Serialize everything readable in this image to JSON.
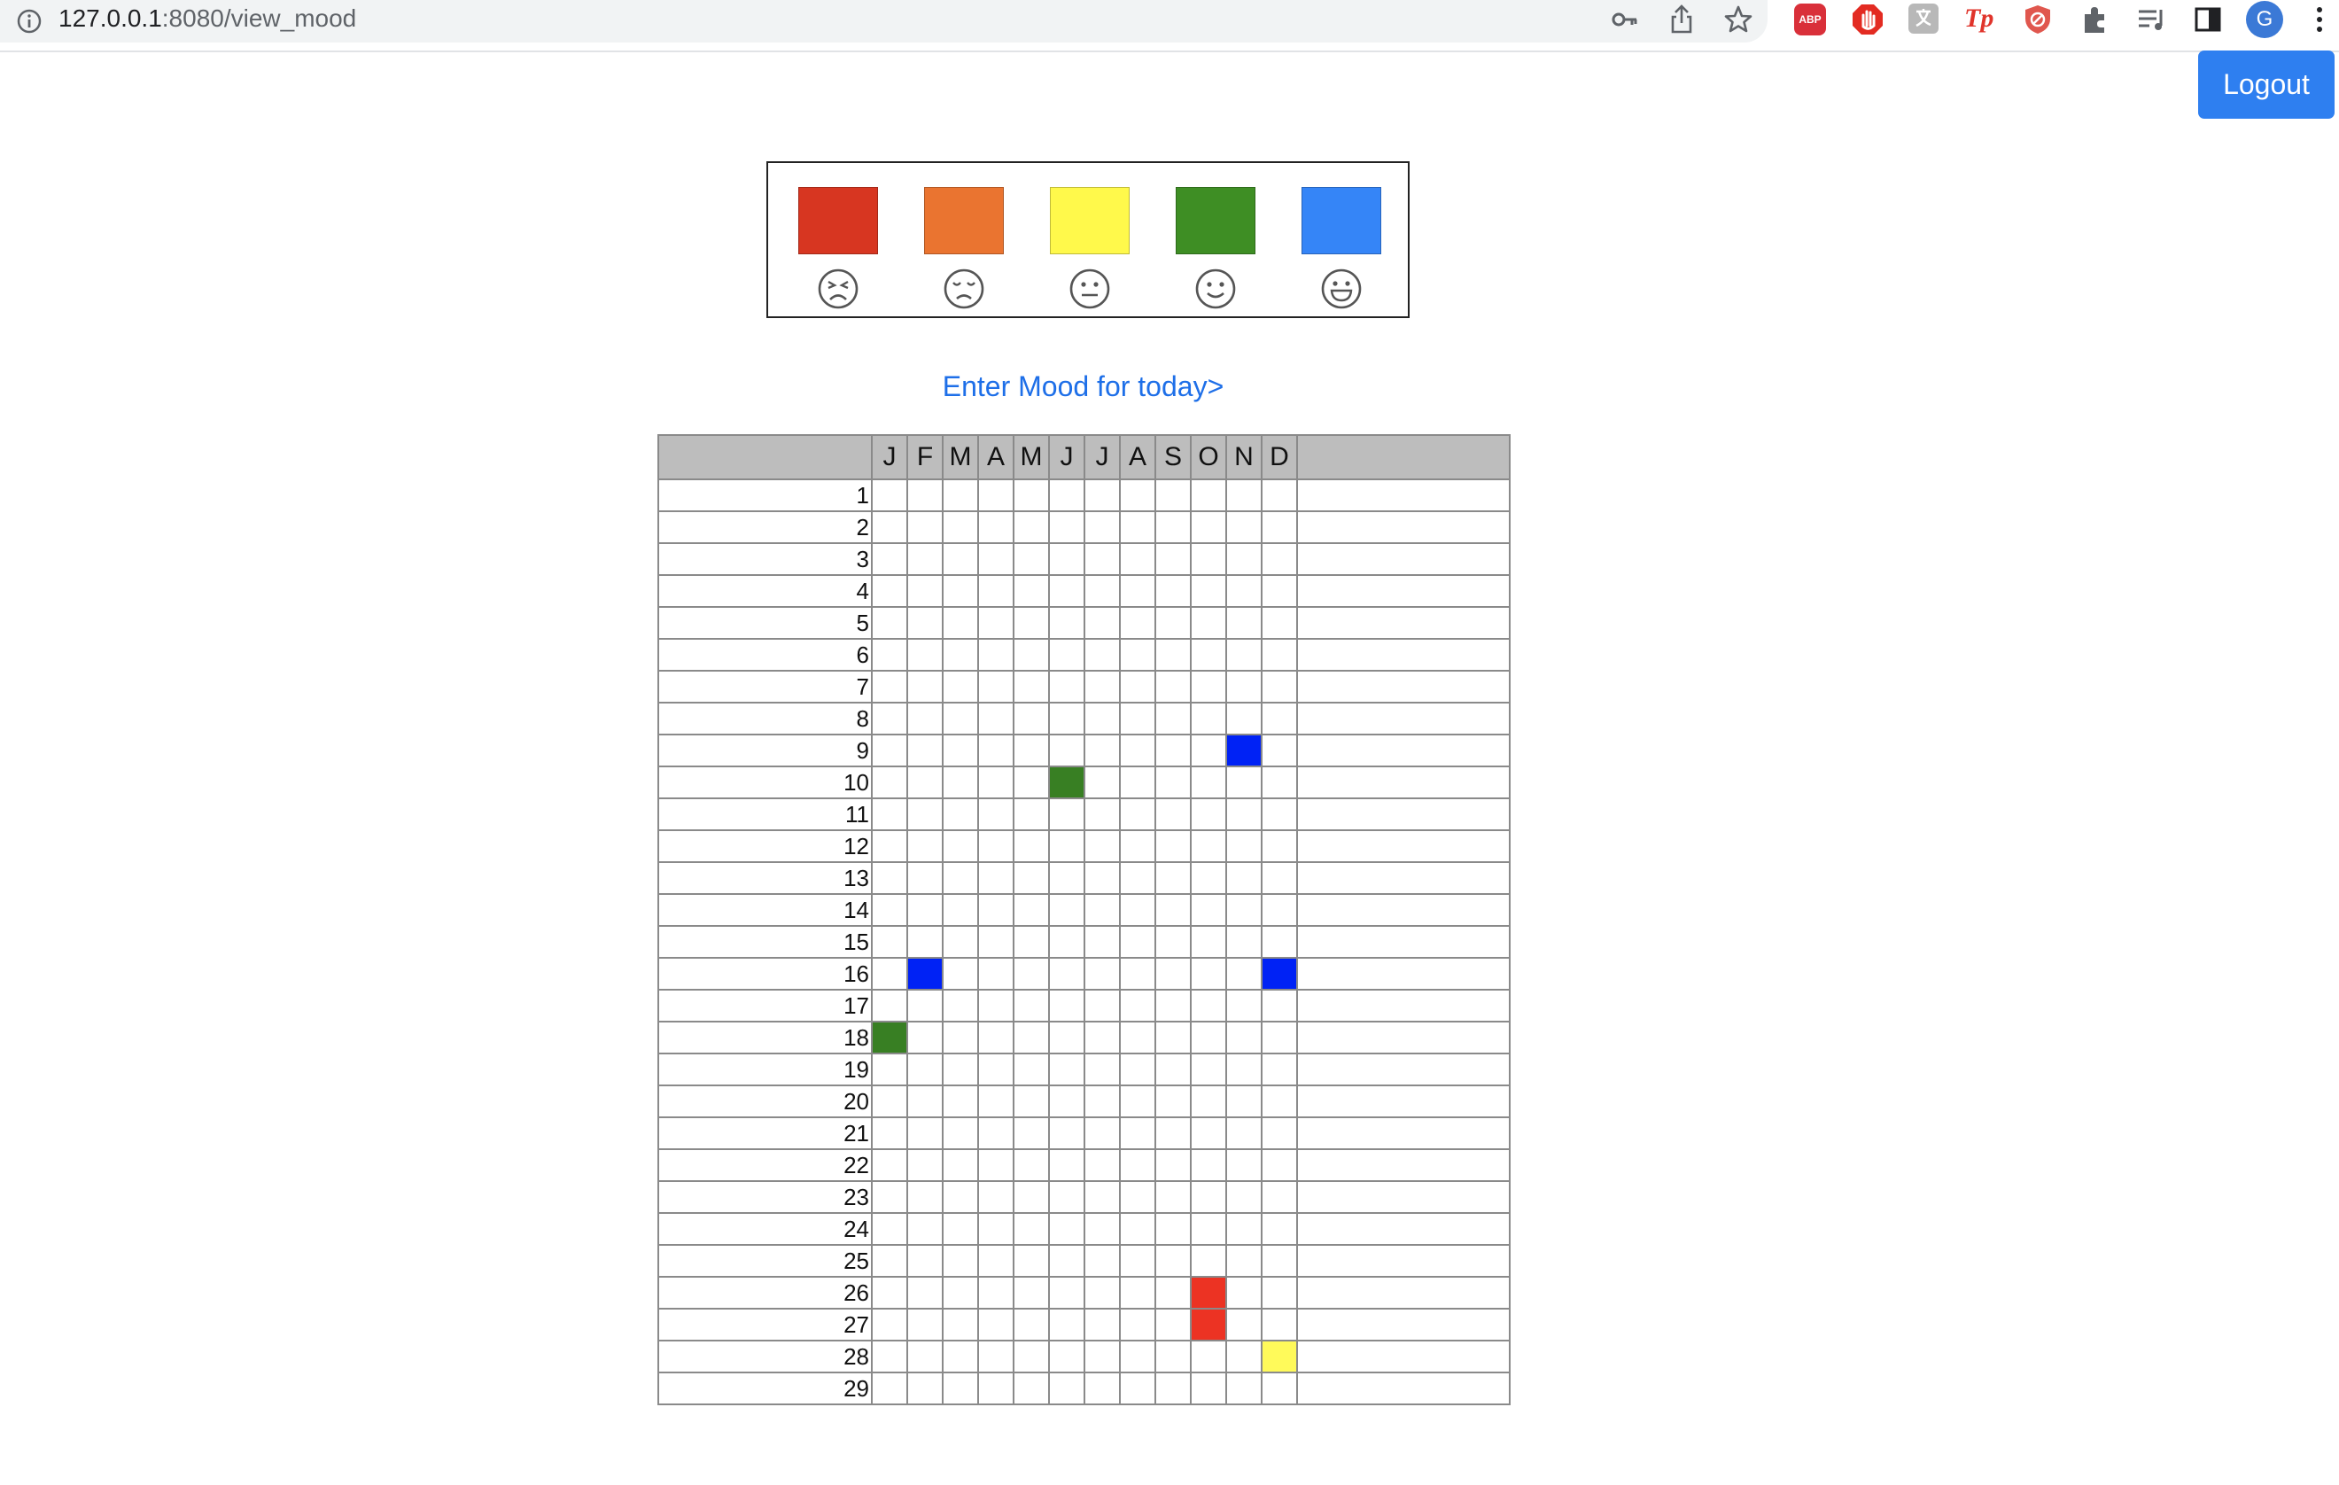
{
  "browser": {
    "url_host": "127.0.0.1",
    "url_path": ":8080/view_mood",
    "profile_initial": "G",
    "extensions": [
      "ABP",
      "Tp"
    ]
  },
  "header": {
    "logout_label": "Logout"
  },
  "legend": [
    {
      "mood": "very-unhappy",
      "color": "#d73621",
      "face": "very-sad-face-icon"
    },
    {
      "mood": "unhappy",
      "color": "#ea7430",
      "face": "sad-face-icon"
    },
    {
      "mood": "neutral",
      "color": "#fff94b",
      "face": "neutral-face-icon"
    },
    {
      "mood": "happy",
      "color": "#3e8e24",
      "face": "smile-face-icon"
    },
    {
      "mood": "very-happy",
      "color": "#3585f7",
      "face": "grin-face-icon"
    }
  ],
  "enter_link": "Enter Mood for today>",
  "calendar": {
    "months": [
      "J",
      "F",
      "M",
      "A",
      "M",
      "J",
      "J",
      "A",
      "S",
      "O",
      "N",
      "D"
    ],
    "days": [
      "1",
      "2",
      "3",
      "4",
      "5",
      "6",
      "7",
      "8",
      "9",
      "10",
      "11",
      "12",
      "13",
      "14",
      "15",
      "16",
      "17",
      "18",
      "19",
      "20",
      "21",
      "22",
      "23",
      "24",
      "25",
      "26",
      "27",
      "28",
      "29"
    ],
    "fill_colors": {
      "blue": "#0022f5",
      "green": "#387f23",
      "red": "#ec3323",
      "yellow": "#fffa5a"
    },
    "entries": [
      {
        "day": 9,
        "month": 11,
        "color": "blue"
      },
      {
        "day": 10,
        "month": 6,
        "color": "green"
      },
      {
        "day": 16,
        "month": 2,
        "color": "blue"
      },
      {
        "day": 16,
        "month": 12,
        "color": "blue"
      },
      {
        "day": 18,
        "month": 1,
        "color": "green"
      },
      {
        "day": 26,
        "month": 10,
        "color": "red"
      },
      {
        "day": 27,
        "month": 10,
        "color": "red"
      },
      {
        "day": 28,
        "month": 12,
        "color": "yellow"
      }
    ]
  }
}
